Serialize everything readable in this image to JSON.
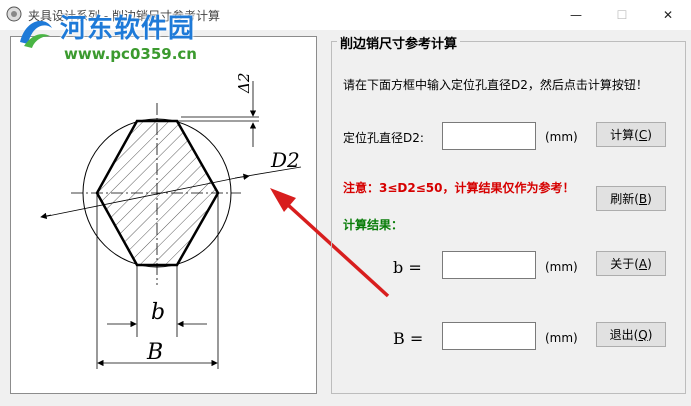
{
  "window": {
    "title": "夹具设计系列 - 削边销尺寸参考计算",
    "minimize_glyph": "—",
    "maximize_glyph": "☐",
    "close_glyph": "✕"
  },
  "watermark": {
    "text": "河东软件园",
    "url": "www.pc0359.cn"
  },
  "diagram": {
    "label_delta2": "Δ2",
    "label_d2": "D2",
    "label_b": "b",
    "label_B": "B"
  },
  "group": {
    "title": "削边销尺寸参考计算",
    "instruction": "请在下面方框中输入定位孔直径D2，然后点击计算按钮！",
    "hole_label": "定位孔直径D2:",
    "hole_value": "",
    "unit": "(mm)",
    "notice": "注意：3≤D2≤50，计算结果仅作为参考！",
    "result_header": "计算结果：",
    "b_label": "b =",
    "b_value": "",
    "B_label": "B =",
    "B_value": ""
  },
  "buttons": {
    "calc": {
      "text": "计算",
      "key": "C"
    },
    "refresh": {
      "text": "刷新",
      "key": "B"
    },
    "about": {
      "text": "关于",
      "key": "A"
    },
    "exit": {
      "text": "退出",
      "key": "Q"
    }
  },
  "colors": {
    "notice": "#d60000",
    "result_header": "#0a7d0a",
    "arrow": "#d81e1e",
    "watermark": "#1e7ad8"
  }
}
